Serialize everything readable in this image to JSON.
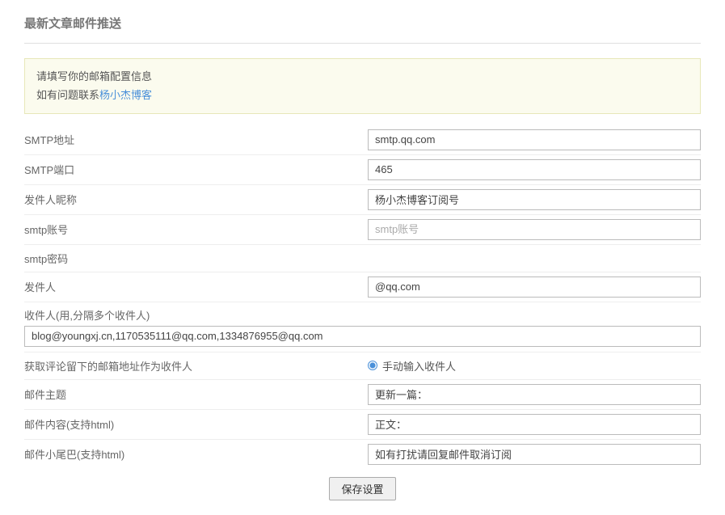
{
  "title": "最新文章邮件推送",
  "notice": {
    "line1": "请填写你的邮箱配置信息",
    "line2_prefix": "如有问题联系",
    "line2_link": "杨小杰博客"
  },
  "fields": {
    "smtp_addr": {
      "label": "SMTP地址",
      "value": "smtp.qq.com"
    },
    "smtp_port": {
      "label": "SMTP端口",
      "value": "465"
    },
    "sender_nick": {
      "label": "发件人昵称",
      "value": "杨小杰博客订阅号"
    },
    "smtp_user": {
      "label": "smtp账号",
      "value": "",
      "placeholder": "smtp账号"
    },
    "smtp_pass": {
      "label": "smtp密码",
      "value": ""
    },
    "sender": {
      "label": "发件人",
      "value": "@qq.com"
    },
    "recipients": {
      "label": "收件人(用,分隔多个收件人)",
      "value": "blog@youngxj.cn,1170535111@qq.com,1334876955@qq.com"
    },
    "fetch_comment": {
      "label": "获取评论留下的邮箱地址作为收件人",
      "radio_label": "手动输入收件人"
    },
    "subject": {
      "label": "邮件主题",
      "value": "更新一篇："
    },
    "content": {
      "label": "邮件内容(支持html)",
      "value": "正文："
    },
    "footer": {
      "label": "邮件小尾巴(支持html)",
      "value": "如有打扰请回复邮件取消订阅"
    }
  },
  "submit": "保存设置"
}
